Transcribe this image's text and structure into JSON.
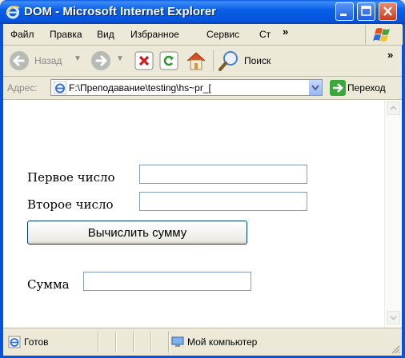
{
  "window": {
    "title": "DOM - Microsoft Internet Explorer"
  },
  "menu": {
    "file": "Файл",
    "edit": "Правка",
    "view": "Вид",
    "favorites": "Избранное",
    "tools": "Сервис",
    "help": "Ст",
    "more": "»"
  },
  "toolbar": {
    "back_label": "Назад",
    "search_label": "Поиск",
    "more": "»"
  },
  "address": {
    "label": "Адрес:",
    "value": "F:\\Преподавание\\testing\\hs~pr_[",
    "go_label": "Переход"
  },
  "form": {
    "first_label": "Первое число",
    "first_value": "",
    "second_label": "Второе число",
    "second_value": "",
    "button_label": "Вычислить сумму",
    "sum_label": "Сумма",
    "sum_value": ""
  },
  "status": {
    "ready": "Готов",
    "zone": "Мой компьютер"
  },
  "colors": {
    "titlebar": "#0553da",
    "chrome": "#ece9d8",
    "field_border": "#7f9db9"
  }
}
